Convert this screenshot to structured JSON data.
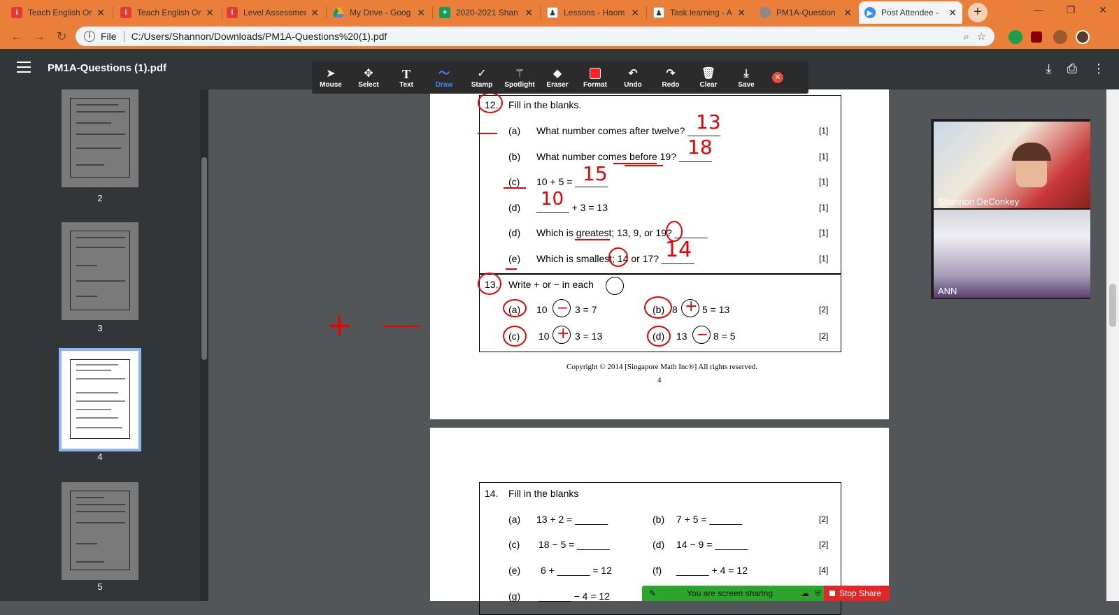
{
  "browser": {
    "tabs": [
      {
        "title": "Teach English On",
        "icon": "i-icon",
        "color": "#e53935"
      },
      {
        "title": "Teach English On",
        "icon": "i-icon",
        "color": "#e53935"
      },
      {
        "title": "Level Assessmen",
        "icon": "i-icon",
        "color": "#e53935"
      },
      {
        "title": "My Drive - Goog",
        "icon": "drive-icon",
        "color": "#f4b400"
      },
      {
        "title": "2020-2021 Shan",
        "icon": "sheets-icon",
        "color": "#0f9d58"
      },
      {
        "title": "Lessons - Haom",
        "icon": "lessons-icon",
        "color": "#ffffff"
      },
      {
        "title": "Task learning - A",
        "icon": "lessons-icon",
        "color": "#ffffff"
      },
      {
        "title": "PM1A-Question",
        "icon": "pdf-icon",
        "color": "#8a8a8a"
      },
      {
        "title": "Post Attendee -",
        "icon": "zoom-icon",
        "color": "#2d8cff"
      }
    ],
    "active_tab_index": 7,
    "address": {
      "scheme_label": "File",
      "url": "C:/Users/Shannon/Downloads/PM1A-Questions%20(1).pdf"
    }
  },
  "pdf_viewer": {
    "document_name": "PM1A-Questions (1).pdf",
    "thumbnails": [
      {
        "page": "2",
        "selected": false
      },
      {
        "page": "3",
        "selected": false
      },
      {
        "page": "4",
        "selected": true
      },
      {
        "page": "5",
        "selected": false
      }
    ]
  },
  "annotation_toolbar": {
    "tools": [
      {
        "label": "Mouse",
        "icon": "cursor-icon"
      },
      {
        "label": "Select",
        "icon": "move-icon"
      },
      {
        "label": "Text",
        "icon": "text-icon"
      },
      {
        "label": "Draw",
        "icon": "draw-icon",
        "active": true
      },
      {
        "label": "Stamp",
        "icon": "check-icon"
      },
      {
        "label": "Spotlight",
        "icon": "wand-icon"
      },
      {
        "label": "Eraser",
        "icon": "eraser-icon"
      },
      {
        "label": "Format",
        "icon": "format-icon"
      },
      {
        "label": "Undo",
        "icon": "undo-icon"
      },
      {
        "label": "Redo",
        "icon": "redo-icon"
      },
      {
        "label": "Clear",
        "icon": "trash-icon"
      },
      {
        "label": "Save",
        "icon": "save-icon"
      }
    ]
  },
  "page4": {
    "q12": {
      "number": "12.",
      "title": "Fill in the blanks.",
      "items": [
        {
          "label": "(a)",
          "text": "What number comes after twelve? ______",
          "mark": "[1]",
          "answer": "13"
        },
        {
          "label": "(b)",
          "text": "What number comes before 19? ______",
          "mark": "[1]",
          "answer": "18"
        },
        {
          "label": "(c)",
          "text": "10 + 5 = ______",
          "mark": "[1]",
          "answer": "15"
        },
        {
          "label": "(d)",
          "text": "______ + 3 = 13",
          "mark": "[1]",
          "answer": "10"
        },
        {
          "label": "(d)",
          "text": "Which is greatest; 13, 9, or 19? ______",
          "mark": "[1]",
          "answer": ""
        },
        {
          "label": "(e)",
          "text": "Which is smallest; 14 or 17? ______",
          "mark": "[1]",
          "answer": "14"
        }
      ]
    },
    "q13": {
      "number": "13.",
      "title": "Write + or − in each",
      "items": [
        {
          "label": "(a)",
          "left": "10",
          "right": "3 = 7",
          "mark": "[2]",
          "answer": "−"
        },
        {
          "label": "(b)",
          "left": "8",
          "right": "5 = 13",
          "mark": "[2]",
          "answer": "+"
        },
        {
          "label": "(c)",
          "left": "10",
          "right": "3 = 13",
          "mark": "[2]",
          "answer": "+"
        },
        {
          "label": "(d)",
          "left": "13",
          "right": "8 = 5",
          "mark": "[2]",
          "answer": "−"
        }
      ]
    },
    "copyright": "Copyright © 2014 [Singapore Math Inc®] All rights reserved.",
    "page_number": "4"
  },
  "page5": {
    "q14": {
      "number": "14.",
      "title": "Fill in the blanks",
      "rows": [
        {
          "l_label": "(a)",
          "l_text": "13 + 2 = ______",
          "r_label": "(b)",
          "r_text": "7 + 5 = ______",
          "mark": "[2]"
        },
        {
          "l_label": "(c)",
          "l_text": "18 − 5 = ______",
          "r_label": "(d)",
          "r_text": "14 − 9 = ______",
          "mark": "[2]"
        },
        {
          "l_label": "(e)",
          "l_text": "6 + ______ = 12",
          "r_label": "(f)",
          "r_text": "______ + 4 = 12",
          "mark": "[4]"
        },
        {
          "l_label": "(g)",
          "l_text": "______ − 4 = 12",
          "r_label": "",
          "r_text": "",
          "mark": ""
        }
      ]
    }
  },
  "zoom": {
    "participants": [
      {
        "name": "Shannon DeConkey"
      },
      {
        "name": "ANN"
      }
    ],
    "share_status": "You are screen sharing",
    "stop_share_label": "Stop Share"
  }
}
